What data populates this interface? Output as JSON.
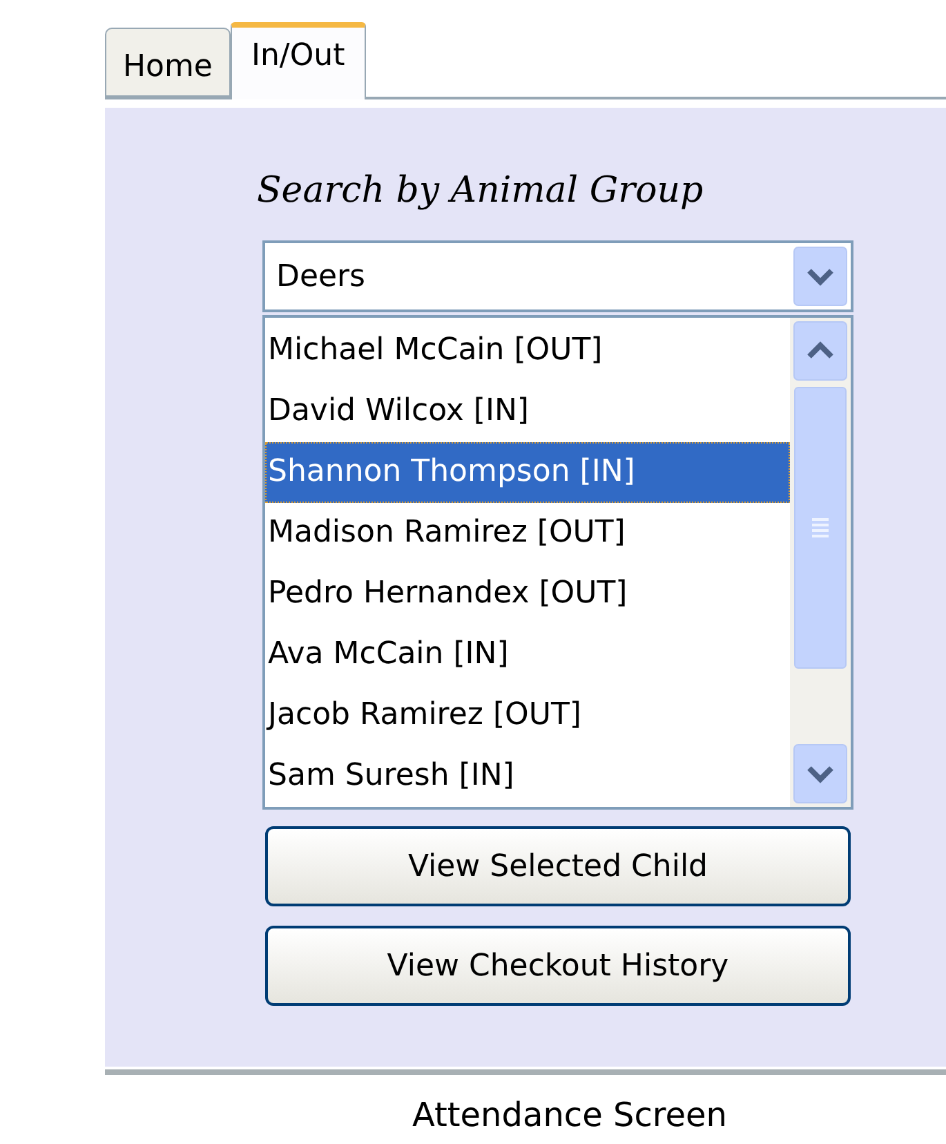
{
  "tabs": [
    {
      "label": "Home",
      "selected": false
    },
    {
      "label": "In/Out",
      "selected": true
    }
  ],
  "heading": "Search by Animal Group",
  "group_dropdown": {
    "value": "Deers"
  },
  "children_list": [
    {
      "label": "Michael McCain [OUT]",
      "selected": false
    },
    {
      "label": "David Wilcox [IN]",
      "selected": false
    },
    {
      "label": "Shannon Thompson [IN]",
      "selected": true
    },
    {
      "label": "Madison Ramirez [OUT]",
      "selected": false
    },
    {
      "label": "Pedro Hernandex [OUT]",
      "selected": false
    },
    {
      "label": "Ava McCain [IN]",
      "selected": false
    },
    {
      "label": "Jacob Ramirez [OUT]",
      "selected": false
    },
    {
      "label": "Sam Suresh [IN]",
      "selected": false
    }
  ],
  "buttons": [
    "View Selected Child",
    "View Checkout History"
  ],
  "caption": "Attendance Screen"
}
